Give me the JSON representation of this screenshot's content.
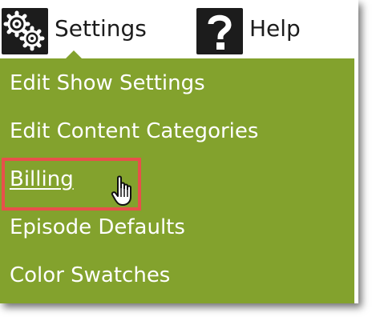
{
  "nav": {
    "settings_label": "Settings",
    "settings_icon": "gears-icon",
    "help_label": "Help",
    "help_icon": "question-mark-icon"
  },
  "menu": {
    "items": [
      {
        "label": "Edit Show Settings"
      },
      {
        "label": "Edit Content Categories"
      },
      {
        "label": "Billing",
        "hovered": true
      },
      {
        "label": "Episode Defaults"
      },
      {
        "label": "Color Swatches"
      }
    ]
  },
  "cursor": "hand-pointer-icon",
  "colors": {
    "menu_bg": "#83a22d",
    "highlight": "#e8504b",
    "icon_bg": "#1c1c1c",
    "text_dark": "#1c1c1c",
    "menu_text": "#ffffff"
  }
}
